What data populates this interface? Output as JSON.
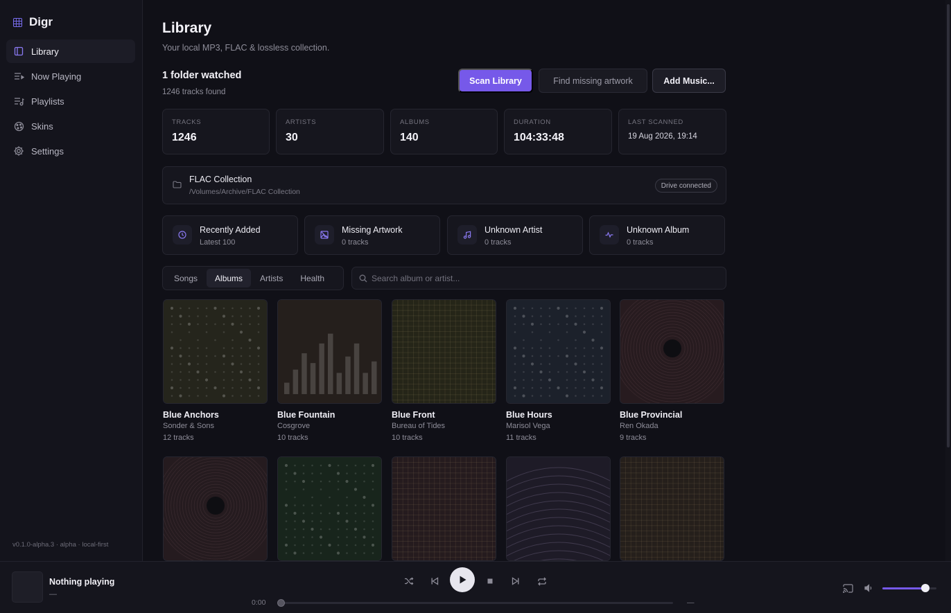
{
  "app": {
    "name": "Digr",
    "version": "v0.1.0-alpha.3 · alpha · local-first",
    "accent": "#7659e9"
  },
  "sidebar": {
    "items": [
      {
        "label": "Library",
        "icon": "library-icon",
        "active": true
      },
      {
        "label": "Now Playing",
        "icon": "now-playing-icon",
        "active": false
      },
      {
        "label": "Playlists",
        "icon": "playlist-icon",
        "active": false
      },
      {
        "label": "Skins",
        "icon": "palette-icon",
        "active": false
      },
      {
        "label": "Settings",
        "icon": "gear-icon",
        "active": false
      }
    ]
  },
  "header": {
    "title": "Library",
    "subtitle": "Your local MP3, FLAC & lossless collection."
  },
  "folder_summary": {
    "title": "1 folder watched",
    "subtitle": "1246 tracks found"
  },
  "actions": {
    "scan": "Scan Library",
    "find_artwork": "Find missing artwork",
    "add_music": "Add Music..."
  },
  "stats": [
    {
      "label": "Tracks",
      "value": "1246"
    },
    {
      "label": "Artists",
      "value": "30"
    },
    {
      "label": "Albums",
      "value": "140"
    },
    {
      "label": "Duration",
      "value": "104:33:48"
    },
    {
      "label": "Last scanned",
      "value": "19 Aug 2026, 19:14"
    }
  ],
  "folder": {
    "name": "FLAC Collection",
    "path": "/Volumes/Archive/FLAC Collection",
    "status": "Drive connected"
  },
  "smart_lists": [
    {
      "title": "Recently Added",
      "subtitle": "Latest 100",
      "icon": "clock-icon"
    },
    {
      "title": "Missing Artwork",
      "subtitle": "0 tracks",
      "icon": "image-missing-icon"
    },
    {
      "title": "Unknown Artist",
      "subtitle": "0 tracks",
      "icon": "music-note-icon"
    },
    {
      "title": "Unknown Album",
      "subtitle": "0 tracks",
      "icon": "pulse-icon"
    }
  ],
  "tabs": [
    {
      "label": "Songs",
      "active": false
    },
    {
      "label": "Albums",
      "active": true
    },
    {
      "label": "Artists",
      "active": false
    },
    {
      "label": "Health",
      "active": false
    }
  ],
  "search": {
    "placeholder": "Search album or artist...",
    "value": ""
  },
  "albums": [
    {
      "name": "Blue Anchors",
      "artist": "Sonder & Sons",
      "tracks": "12 tracks",
      "art": "dots",
      "tint": "#3a3a2c"
    },
    {
      "name": "Blue Fountain",
      "artist": "Cosgrove",
      "tracks": "10 tracks",
      "art": "bars",
      "tint": "#3a302c"
    },
    {
      "name": "Blue Front",
      "artist": "Bureau of Tides",
      "tracks": "10 tracks",
      "art": "grid",
      "tint": "#3a3a26"
    },
    {
      "name": "Blue Hours",
      "artist": "Marisol Vega",
      "tracks": "11 tracks",
      "art": "dots",
      "tint": "#2c3342"
    },
    {
      "name": "Blue Provincial",
      "artist": "Ren Okada",
      "tracks": "9 tracks",
      "art": "rings",
      "tint": "#3c2a30"
    },
    {
      "name": "",
      "artist": "",
      "tracks": "",
      "art": "rings",
      "tint": "#3a2a30"
    },
    {
      "name": "",
      "artist": "",
      "tracks": "",
      "art": "dots",
      "tint": "#263a2c"
    },
    {
      "name": "",
      "artist": "",
      "tracks": "",
      "art": "grid",
      "tint": "#3a2a2e"
    },
    {
      "name": "",
      "artist": "",
      "tracks": "",
      "art": "arcs",
      "tint": "#2e2a3c"
    },
    {
      "name": "",
      "artist": "",
      "tracks": "",
      "art": "grid",
      "tint": "#3a302a"
    }
  ],
  "player": {
    "title": "Nothing playing",
    "artist": "—",
    "time_current": "0:00",
    "time_total": "—",
    "progress": 0,
    "volume": 0.8
  }
}
